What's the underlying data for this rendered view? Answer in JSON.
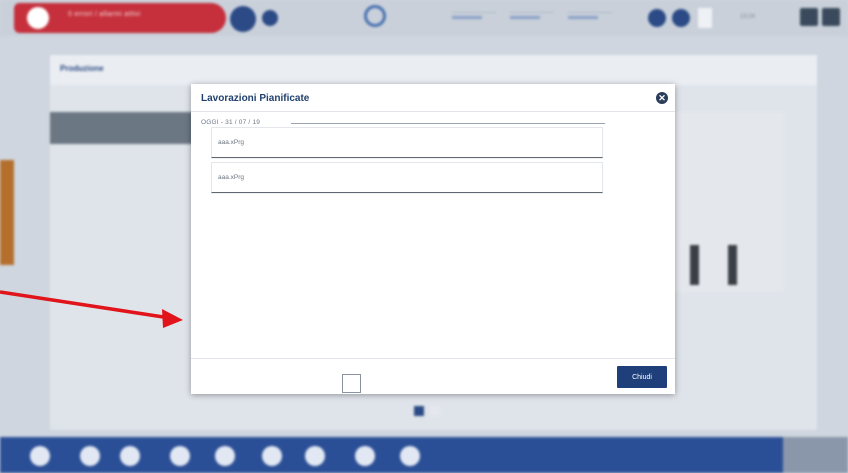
{
  "header": {
    "alarm_text": "0 errori / allarmi attivi",
    "clock": "13:24"
  },
  "panel": {
    "title": "Produzione"
  },
  "modal": {
    "title": "Lavorazioni Pianificate",
    "section_label": "OGGI - 31 / 07 / 19",
    "items": [
      {
        "label": "aaa.xPrg"
      },
      {
        "label": "aaa.xPrg"
      }
    ],
    "close_button": "Chiudi"
  },
  "colors": {
    "accent": "#1f3f7a",
    "alarm": "#c5303c",
    "arrow": "#e0141a",
    "nav": "#2b4f96"
  },
  "icons": {
    "close": "close-icon",
    "alarm": "alert-icon"
  }
}
